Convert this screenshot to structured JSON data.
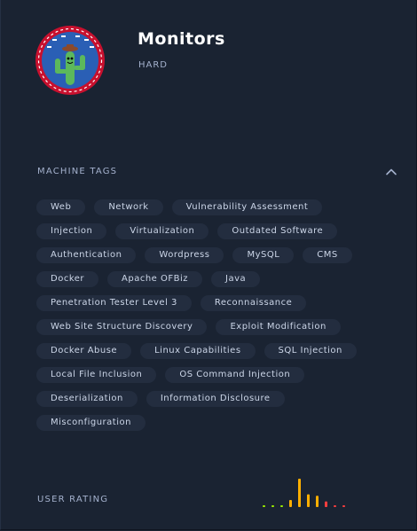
{
  "machine": {
    "name": "Monitors",
    "difficulty": "HARD"
  },
  "tags_section": {
    "title": "MACHINE TAGS",
    "tags": [
      "Web",
      "Network",
      "Vulnerability Assessment",
      "Injection",
      "Virtualization",
      "Outdated Software",
      "Authentication",
      "Wordpress",
      "MySQL",
      "CMS",
      "Docker",
      "Apache OFBiz",
      "Java",
      "Penetration Tester Level 3",
      "Reconnaissance",
      "Web Site Structure Discovery",
      "Exploit Modification",
      "Docker Abuse",
      "Linux Capabilities",
      "SQL Injection",
      "Local File Inclusion",
      "OS Command Injection",
      "Deserialization",
      "Information Disclosure",
      "Misconfiguration"
    ]
  },
  "rating_section": {
    "title": "USER RATING",
    "bars": [
      {
        "level": 0.06,
        "color": "#9fef00"
      },
      {
        "level": 0.06,
        "color": "#9fef00"
      },
      {
        "level": 0.06,
        "color": "#9fef00"
      },
      {
        "level": 0.25,
        "color": "#ffaf00"
      },
      {
        "level": 1.0,
        "color": "#ffaf00"
      },
      {
        "level": 0.45,
        "color": "#ffaf00"
      },
      {
        "level": 0.4,
        "color": "#ffaf00"
      },
      {
        "level": 0.2,
        "color": "#ff3e3e"
      },
      {
        "level": 0.06,
        "color": "#ff3e3e"
      },
      {
        "level": 0.06,
        "color": "#ff3e3e"
      }
    ]
  },
  "colors": {
    "background": "#1a2332",
    "tag_background": "#232d3f",
    "text": "#a4b1cd"
  }
}
